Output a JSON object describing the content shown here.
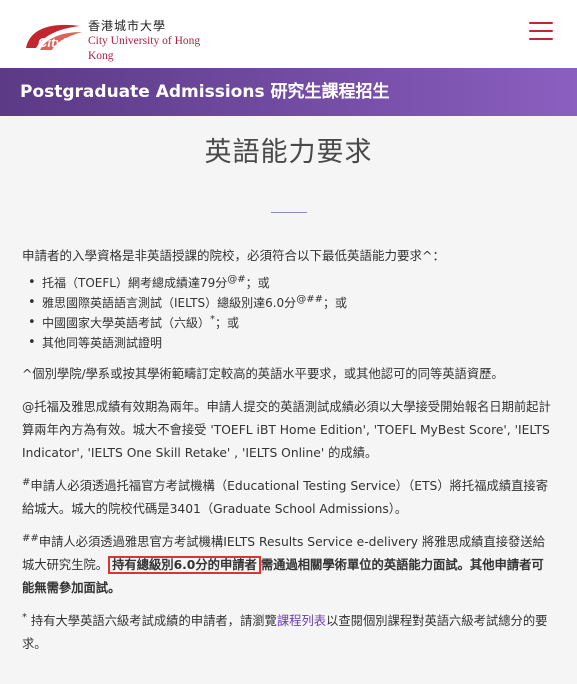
{
  "header": {
    "logo_cn": "香港城市大學",
    "logo_en": "City University of Hong Kong",
    "logo_mark_text": "CityU"
  },
  "banner": {
    "title": "Postgraduate Admissions 研究生課程招生"
  },
  "page": {
    "title": "英語能力要求",
    "intro": "申請者的入學資格是非英語授課的院校，必須符合以下最低英語能力要求^：",
    "requirements": [
      {
        "text": "托福（TOEFL）網考總成績達79分",
        "sup": "@#",
        "tail": "；或"
      },
      {
        "text": "雅思國際英語語言測試（IELTS）總級別達6.0分",
        "sup": "@##",
        "tail": "；或"
      },
      {
        "text": "中國國家大學英語考試（六級）",
        "sup": "*",
        "tail": "；或"
      },
      {
        "text": "其他同等英語測試證明",
        "sup": "",
        "tail": ""
      }
    ],
    "note_caret": "^個別學院/學系或按其學術範疇訂定較高的英語水平要求，或其他認可的同等英語資歷。",
    "note_at": "@托福及雅思成績有效期為兩年。申請人提交的英語測試成績必須以大學接受開始報名日期前起計算兩年內方為有效。城大不會接受 'TOEFL iBT Home Edition', 'TOEFL MyBest Score', 'IELTS Indicator', 'IELTS One Skill Retake' , 'IELTS Online' 的成績。",
    "note_hash_sup": "#",
    "note_hash": "申請人必須透過托福官方考試機構（Educational Testing Service）（ETS）將托福成績直接寄給城大。城大的院校代碼是3401（Graduate School Admissions）。",
    "note_dhash_sup": "##",
    "note_dhash_a": "申請人必須透過雅思官方考試機構IELTS Results Service e-delivery 將雅思成績直接發送給城大研究生院。",
    "note_dhash_highlight": "持有總級別6.0分的申請者",
    "note_dhash_b": "需通過相關學術單位的英語能力面試。其他申請者可能無需參加面試。",
    "note_star_sup": "*",
    "note_star_a": " 持有大學英語六級考試成績的申請者，請瀏覽",
    "note_star_link": "課程列表",
    "note_star_b": "以查閱個別課程對英語六級考試總分的要求。"
  }
}
